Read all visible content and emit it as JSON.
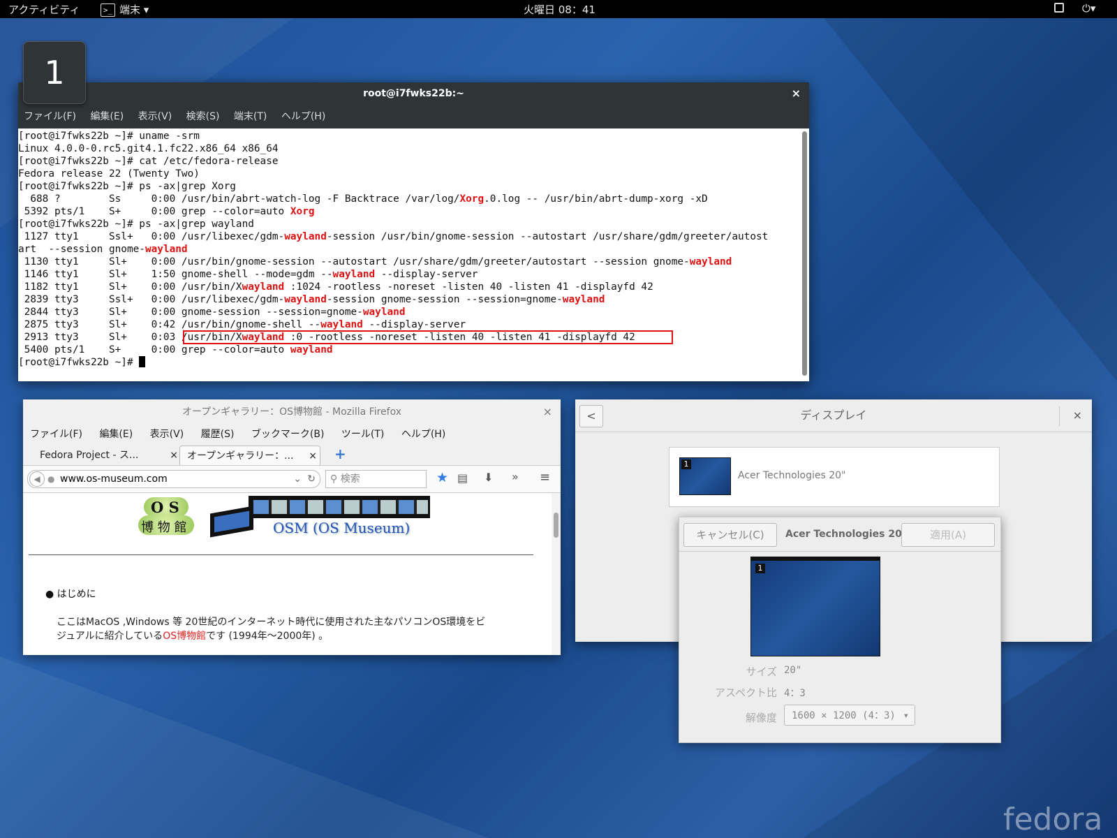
{
  "topbar": {
    "activities": "アクティビティ",
    "app_menu": "端末",
    "app_menu_arrow": "▾",
    "clock": "火曜日 08：41",
    "window_icon": "window-icon",
    "power_icon": "⏻▾"
  },
  "workspace": {
    "number": "1"
  },
  "terminal": {
    "title": "root@i7fwks22b:~",
    "close": "×",
    "menu": [
      "ファイル(F)",
      "編集(E)",
      "表示(V)",
      "検索(S)",
      "端末(T)",
      "ヘルプ(H)"
    ],
    "lines": [
      [
        {
          "t": "[root@i7fwks22b ~]# uname -srm"
        }
      ],
      [
        {
          "t": "Linux 4.0.0-0.rc5.git4.1.fc22.x86_64 x86_64"
        }
      ],
      [
        {
          "t": "[root@i7fwks22b ~]# cat /etc/fedora-release"
        }
      ],
      [
        {
          "t": "Fedora release 22 (Twenty Two)"
        }
      ],
      [
        {
          "t": "[root@i7fwks22b ~]# ps -ax|grep Xorg"
        }
      ],
      [
        {
          "t": "  688 ?        Ss     0:00 /usr/bin/abrt-watch-log -F Backtrace /var/log/"
        },
        {
          "t": "Xorg",
          "r": true
        },
        {
          "t": ".0.log -- /usr/bin/abrt-dump-xorg -xD"
        }
      ],
      [
        {
          "t": " 5392 pts/1    S+     0:00 grep --color=auto "
        },
        {
          "t": "Xorg",
          "r": true
        }
      ],
      [
        {
          "t": "[root@i7fwks22b ~]# ps -ax|grep wayland"
        }
      ],
      [
        {
          "t": " 1127 tty1     Ssl+   0:00 /usr/libexec/gdm-"
        },
        {
          "t": "wayland",
          "r": true
        },
        {
          "t": "-session /usr/bin/gnome-session --autostart /usr/share/gdm/greeter/autost"
        }
      ],
      [
        {
          "t": "art  --session gnome-"
        },
        {
          "t": "wayland",
          "r": true
        }
      ],
      [
        {
          "t": " 1130 tty1     Sl+    0:00 /usr/bin/gnome-session --autostart /usr/share/gdm/greeter/autostart --session gnome-"
        },
        {
          "t": "wayland",
          "r": true
        }
      ],
      [
        {
          "t": " 1146 tty1     Sl+    1:50 gnome-shell --mode=gdm --"
        },
        {
          "t": "wayland",
          "r": true
        },
        {
          "t": " --display-server"
        }
      ],
      [
        {
          "t": " 1182 tty1     Sl+    0:00 /usr/bin/X"
        },
        {
          "t": "wayland",
          "r": true
        },
        {
          "t": " :1024 -rootless -noreset -listen 40 -listen 41 -displayfd 42"
        }
      ],
      [
        {
          "t": " 2839 tty3     Ssl+   0:00 /usr/libexec/gdm-"
        },
        {
          "t": "wayland",
          "r": true
        },
        {
          "t": "-session gnome-session --session=gnome-"
        },
        {
          "t": "wayland",
          "r": true
        }
      ],
      [
        {
          "t": " 2844 tty3     Sl+    0:00 gnome-session --session=gnome-"
        },
        {
          "t": "wayland",
          "r": true
        }
      ],
      [
        {
          "t": " 2875 tty3     Sl+    0:42 /usr/bin/gnome-shell --"
        },
        {
          "t": "wayland",
          "r": true
        },
        {
          "t": " --display-server"
        }
      ],
      [
        {
          "t": " 2913 tty3     Sl+    0:03 /usr/bin/X"
        },
        {
          "t": "wayland",
          "r": true
        },
        {
          "t": " :0 -rootless -noreset -listen 40 -listen 41 -displayfd 42"
        }
      ],
      [
        {
          "t": " 5400 pts/1    S+     0:00 grep --color=auto "
        },
        {
          "t": "wayland",
          "r": true
        }
      ],
      [
        {
          "t": "[root@i7fwks22b ~]# "
        }
      ]
    ]
  },
  "firefox": {
    "title": "オープンギャラリー：OS博物館 - Mozilla Firefox",
    "close": "×",
    "menu": [
      "ファイル(F)",
      "編集(E)",
      "表示(V)",
      "履歴(S)",
      "ブックマーク(B)",
      "ツール(T)",
      "ヘルプ(H)"
    ],
    "tabs": [
      {
        "label": "Fedora Project - ス...",
        "close": "×"
      },
      {
        "label": "オープンギャラリー：...",
        "close": "×"
      }
    ],
    "new_tab": "+",
    "url": "www.os-museum.com",
    "search_placeholder": "検索",
    "logo_text_top": "O S",
    "logo_text_bottom": "博 物 館",
    "banner_text": "OSM (OS Museum)",
    "bullet": "はじめに",
    "paragraph_1": "ここはMacOS ,Windows 等 20世紀のインターネット時代に使用された主なパソコンOS環境をビ",
    "paragraph_2a": "ジュアルに紹介している",
    "paragraph_2_link": "OS博物館",
    "paragraph_2b": "です (1994年～2000年) 。"
  },
  "display_settings": {
    "title": "ディスプレイ",
    "back": "<",
    "close": "×",
    "monitor_name": "Acer Technologies 20\"",
    "monitor_number": "1"
  },
  "monitor_dialog": {
    "cancel": "キャンセル(C)",
    "title": "Acer Technologies 20\"",
    "apply": "適用(A)",
    "monitor_number": "1",
    "size_label": "サイズ",
    "size_value": "20\"",
    "aspect_label": "アスペクト比",
    "aspect_value": "4：3",
    "resolution_label": "解像度",
    "resolution_value": "1600 × 1200 (4：3)",
    "resolution_arrow": "▾"
  },
  "watermark": "fedora"
}
